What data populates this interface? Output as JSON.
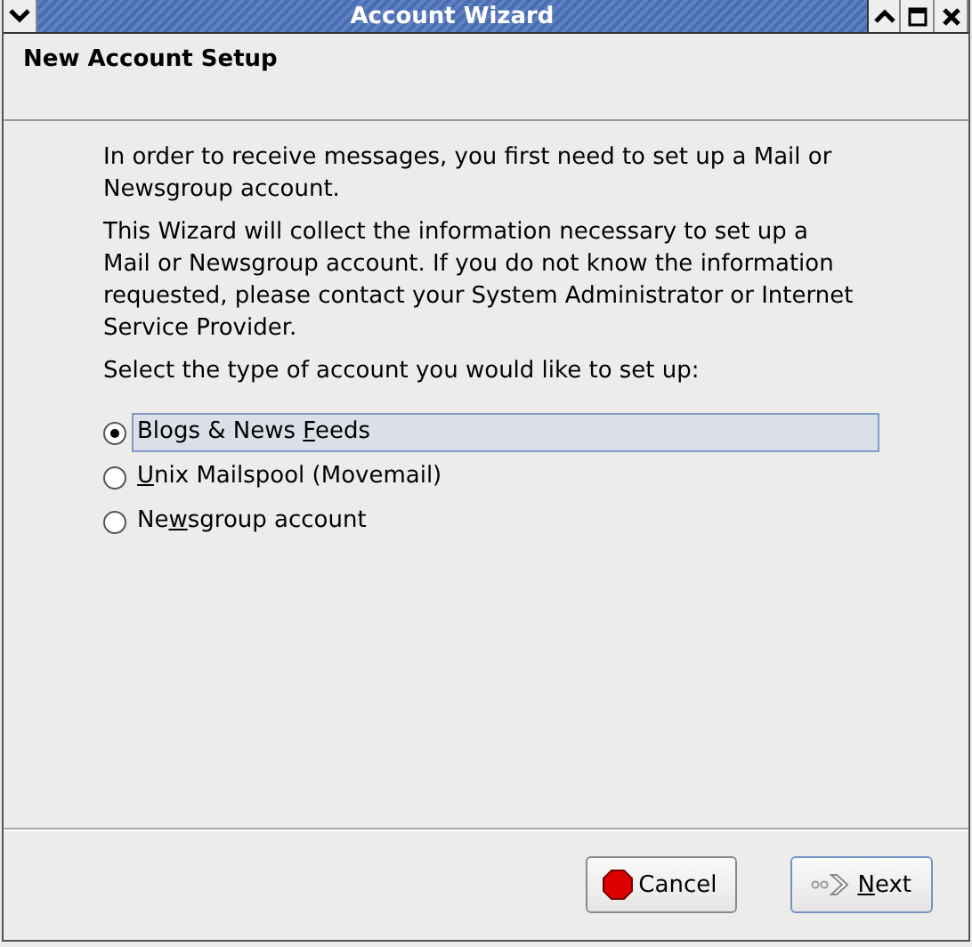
{
  "window": {
    "title": "Account Wizard"
  },
  "header": {
    "title": "New Account Setup"
  },
  "paragraphs": [
    "In order to receive messages, you first need to set up a Mail or Newsgroup account.",
    "This Wizard will collect the information necessary to set up a Mail or Newsgroup account. If you do not know the information requested, please contact your System Administrator or Internet Service Provider.",
    "Select the type of account you would like to set up:"
  ],
  "options": [
    {
      "label": {
        "pre": "Blogs & News ",
        "key": "F",
        "post": "eeds"
      },
      "selected": true
    },
    {
      "label": {
        "key": "U",
        "post": "nix Mailspool (Movemail)"
      },
      "selected": false
    },
    {
      "label": {
        "pre": "Ne",
        "key": "w",
        "post": "sgroup account"
      },
      "selected": false
    }
  ],
  "buttons": [
    {
      "kind": "cancel",
      "label": {
        "pre": "Cancel"
      },
      "focused": false
    },
    {
      "kind": "next",
      "label": {
        "key": "N",
        "post": "ext"
      },
      "focused": true
    }
  ]
}
